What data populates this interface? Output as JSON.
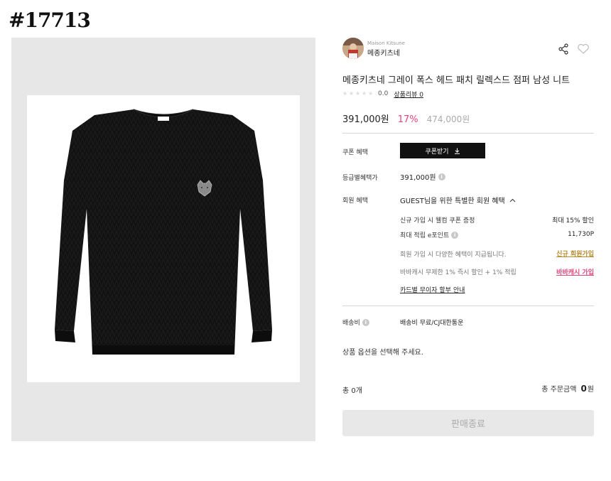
{
  "tag": "#17713",
  "brand": {
    "name_en": "Maison Kitsune",
    "name_ko": "메종키츠네"
  },
  "product": {
    "title": "메종키츠네 그레이 폭스 헤드 패치 릴렉스드 점퍼 남성 니트",
    "rating": "0.0",
    "review_link": "상품리뷰 0",
    "price": "391,000원",
    "discount": "17%",
    "original_price": "474,000원"
  },
  "benefits": {
    "coupon_label": "쿠폰 혜택",
    "coupon_button": "쿠폰받기",
    "grade_label": "등급별혜택가",
    "grade_price": "391,000원",
    "member_label": "회원 혜택",
    "member_header": "GUEST님을 위한 특별한 회원 혜택",
    "rows": [
      {
        "left": "신규 가입 시 웰컴 쿠폰 증정",
        "right": "최대 15% 할인"
      },
      {
        "left": "최대 적립 e포인트",
        "right": "11,730P"
      },
      {
        "left": "회원 가입 시 다양한 혜택이 지급됩니다.",
        "right": "신규 회원가입"
      },
      {
        "left": "바바캐시 무제한 1% 즉시 할인 + 1% 적립",
        "right": "바바캐시 가입"
      }
    ],
    "card_link": "카드별 무이자 할부 안내"
  },
  "shipping": {
    "label": "배송비",
    "value": "배송비 무료/CJ대한통운"
  },
  "option_prompt": "상품 옵션을 선택해 주세요.",
  "total": {
    "count": "총 0개",
    "label": "총 주문금액",
    "amount": "0",
    "unit": "원"
  },
  "soldout_button": "판매종료",
  "colors": {
    "accent_pink": "#e0457a",
    "accent_gold": "#b58a2f",
    "button_dark": "#111111"
  },
  "icons": {
    "share": "share-icon",
    "heart": "heart-outline-icon",
    "download": "download-icon",
    "chevron": "chevron-up-icon",
    "info": "info-icon"
  }
}
